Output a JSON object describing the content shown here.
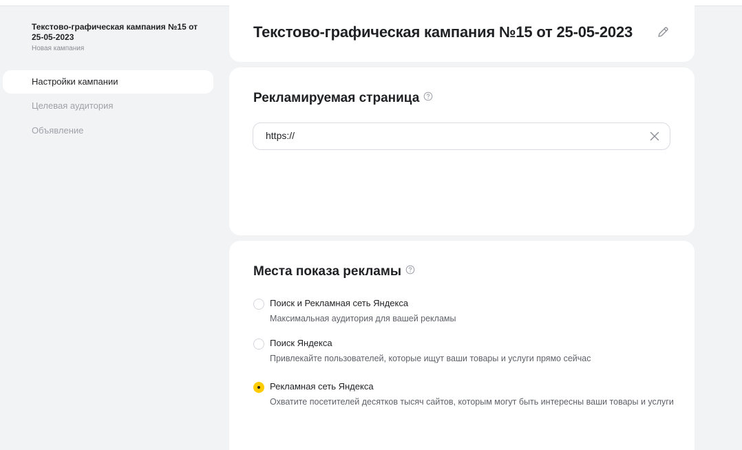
{
  "sidebar": {
    "campaign_title": "Текстово-графическая кампания №15 от 25-05-2023",
    "campaign_status": "Новая кампания",
    "items": [
      {
        "label": "Настройки кампании",
        "active": true
      },
      {
        "label": "Целевая аудитория",
        "active": false
      },
      {
        "label": "Объявление",
        "active": false
      }
    ]
  },
  "header": {
    "title": "Текстово-графическая кампания №15 от 25-05-2023",
    "edit_icon": "pencil-icon"
  },
  "landing_page": {
    "title": "Рекламируемая страница",
    "url_value": "https://",
    "clear_icon": "close-icon"
  },
  "placements": {
    "title": "Места показа рекламы",
    "options": [
      {
        "label": "Поиск и Рекламная сеть Яндекса",
        "desc": "Максимальная аудитория для вашей рекламы",
        "selected": false
      },
      {
        "label": "Поиск Яндекса",
        "desc": "Привлекайте пользователей, которые ищут ваши товары и услуги прямо сейчас",
        "selected": false
      },
      {
        "label": "Рекламная сеть Яндекса",
        "desc": "Охватите посетителей десятков тысяч сайтов, которым могут быть интересны ваши товары и услуги",
        "selected": true
      }
    ]
  },
  "colors": {
    "accent": "#ffcc00",
    "background": "#f2f3f5",
    "card": "#ffffff",
    "muted_text": "#9ea1a8"
  }
}
